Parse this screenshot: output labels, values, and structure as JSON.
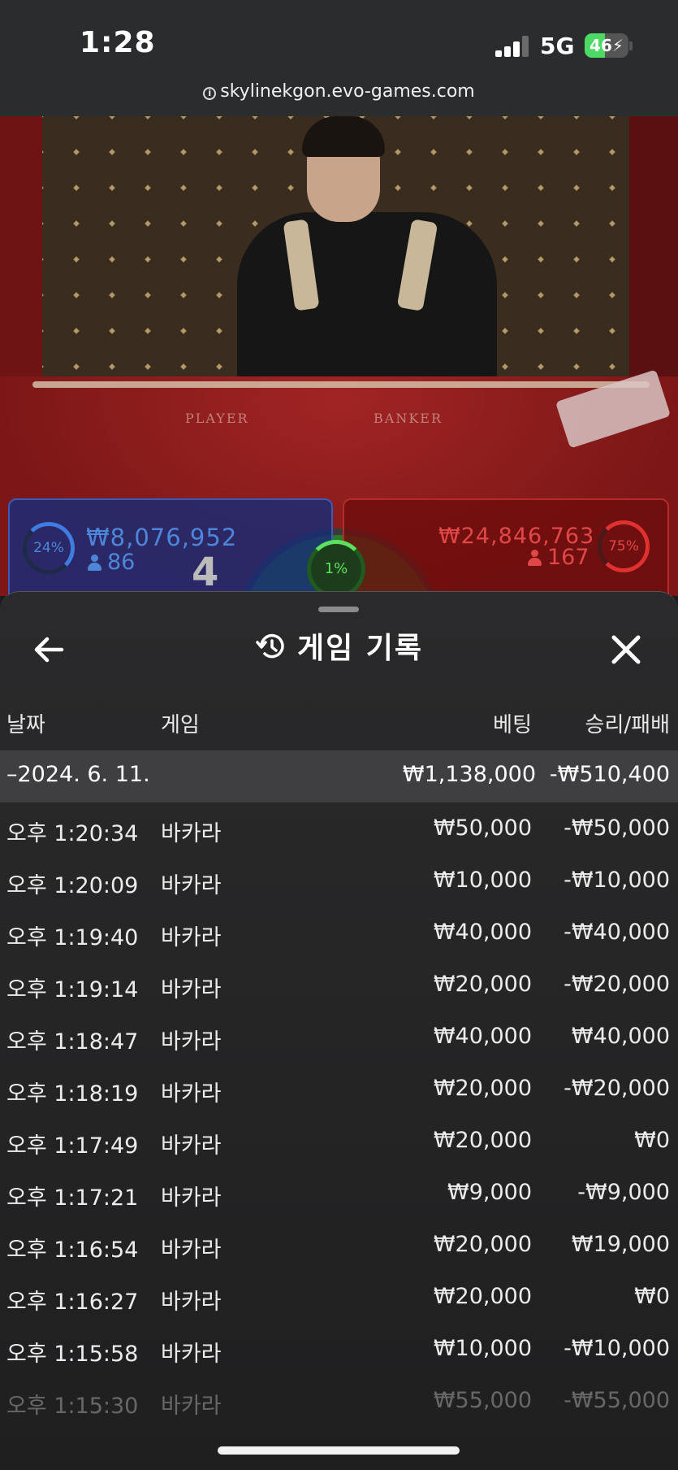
{
  "status_bar": {
    "time": "1:28",
    "network": "5G",
    "battery": "46",
    "battery_level": 0.46
  },
  "browser": {
    "url": "skylinekgon.evo-games.com"
  },
  "game_view": {
    "felt_labels": {
      "player": "PLAYER",
      "banker": "BANKER"
    },
    "player": {
      "percent": "24%",
      "amount": "₩8,076,952",
      "players": "86"
    },
    "banker": {
      "percent": "75%",
      "amount": "₩24,846,763",
      "players": "167"
    },
    "tie": {
      "percent": "1%"
    },
    "cards_count": "4"
  },
  "sheet": {
    "title": "게임 기록",
    "columns": {
      "date": "날짜",
      "game": "게임",
      "bet": "베팅",
      "result": "승리/패배"
    },
    "date_group": {
      "date": "–2024. 6. 11.",
      "bet": "₩1,138,000",
      "result": "-₩510,400"
    },
    "rows": [
      {
        "time": "오후 1:20:34",
        "game": "바카라",
        "bet": "₩50,000",
        "result": "-₩50,000"
      },
      {
        "time": "오후 1:20:09",
        "game": "바카라",
        "bet": "₩10,000",
        "result": "-₩10,000"
      },
      {
        "time": "오후 1:19:40",
        "game": "바카라",
        "bet": "₩40,000",
        "result": "-₩40,000"
      },
      {
        "time": "오후 1:19:14",
        "game": "바카라",
        "bet": "₩20,000",
        "result": "-₩20,000"
      },
      {
        "time": "오후 1:18:47",
        "game": "바카라",
        "bet": "₩40,000",
        "result": "₩40,000"
      },
      {
        "time": "오후 1:18:19",
        "game": "바카라",
        "bet": "₩20,000",
        "result": "-₩20,000"
      },
      {
        "time": "오후 1:17:49",
        "game": "바카라",
        "bet": "₩20,000",
        "result": "₩0"
      },
      {
        "time": "오후 1:17:21",
        "game": "바카라",
        "bet": "₩9,000",
        "result": "-₩9,000"
      },
      {
        "time": "오후 1:16:54",
        "game": "바카라",
        "bet": "₩20,000",
        "result": "₩19,000"
      },
      {
        "time": "오후 1:16:27",
        "game": "바카라",
        "bet": "₩20,000",
        "result": "₩0"
      },
      {
        "time": "오후 1:15:58",
        "game": "바카라",
        "bet": "₩10,000",
        "result": "-₩10,000"
      },
      {
        "time": "오후 1:15:30",
        "game": "바카라",
        "bet": "₩55,000",
        "result": "-₩55,000"
      }
    ]
  },
  "colors": {
    "player_blue": "#4d86d9",
    "banker_red": "#e04747",
    "tie_green": "#5de05d",
    "battery_green": "#4cd964"
  }
}
